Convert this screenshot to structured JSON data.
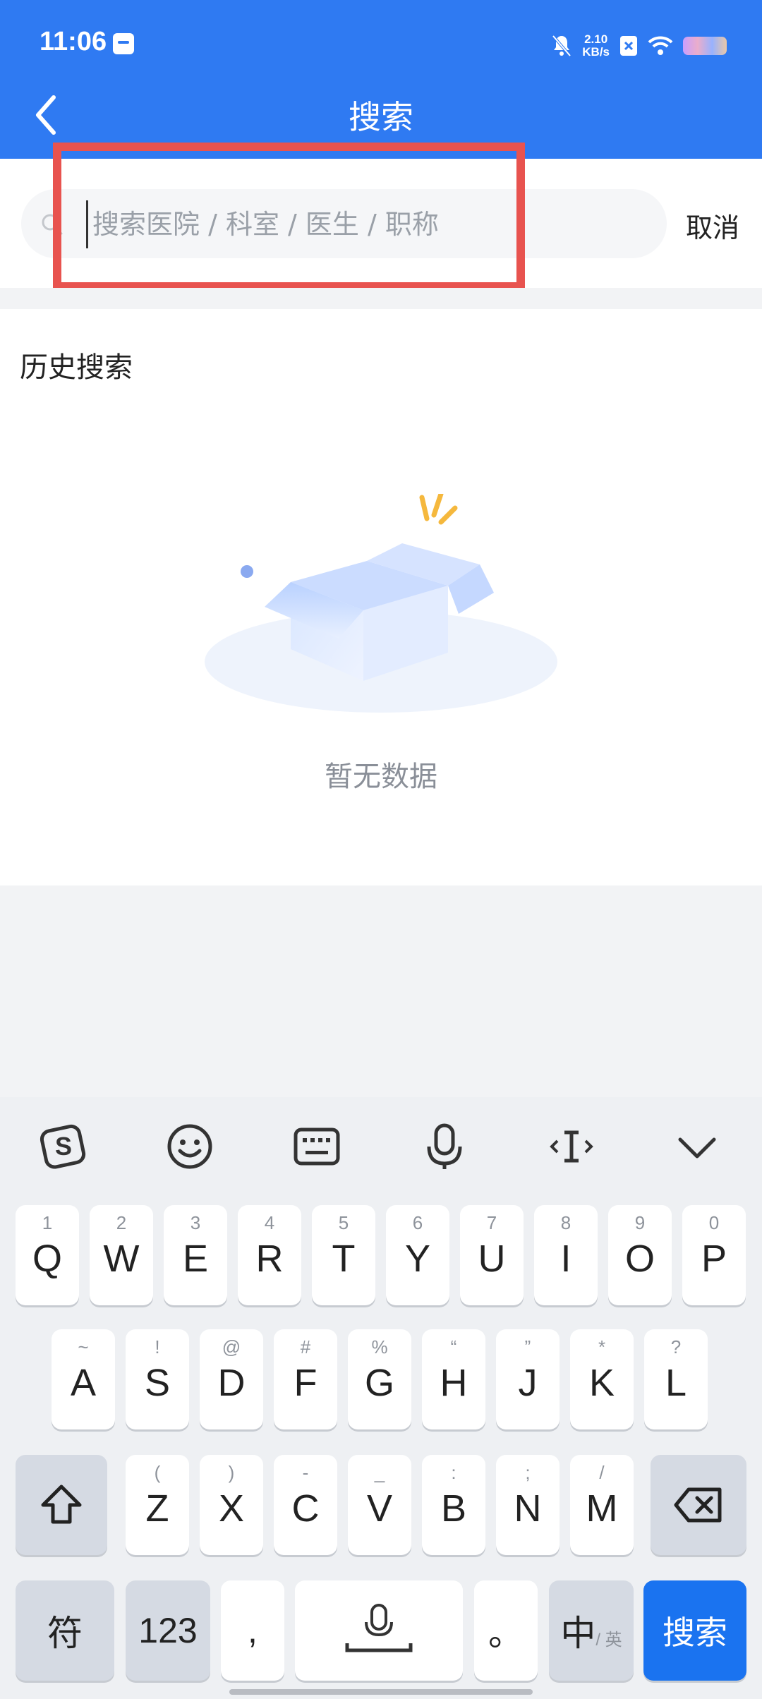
{
  "status_bar": {
    "time": "11:06",
    "net_speed_value": "2.10",
    "net_speed_unit": "KB/s"
  },
  "header": {
    "title": "搜索"
  },
  "search": {
    "placeholder": "搜索医院 / 科室 / 医生 / 职称",
    "value": "",
    "cancel_label": "取消"
  },
  "history": {
    "title": "历史搜索",
    "empty_text": "暂无数据"
  },
  "keyboard": {
    "toolbar": [
      "sogou-logo-icon",
      "emoji-icon",
      "keyboard-icon",
      "microphone-icon",
      "cursor-icon",
      "chevron-down-icon"
    ],
    "row1": [
      {
        "hint": "1",
        "key": "Q"
      },
      {
        "hint": "2",
        "key": "W"
      },
      {
        "hint": "3",
        "key": "E"
      },
      {
        "hint": "4",
        "key": "R"
      },
      {
        "hint": "5",
        "key": "T"
      },
      {
        "hint": "6",
        "key": "Y"
      },
      {
        "hint": "7",
        "key": "U"
      },
      {
        "hint": "8",
        "key": "I"
      },
      {
        "hint": "9",
        "key": "O"
      },
      {
        "hint": "0",
        "key": "P"
      }
    ],
    "row2": [
      {
        "hint": "~",
        "key": "A"
      },
      {
        "hint": "!",
        "key": "S"
      },
      {
        "hint": "@",
        "key": "D"
      },
      {
        "hint": "#",
        "key": "F"
      },
      {
        "hint": "%",
        "key": "G"
      },
      {
        "hint": "“",
        "key": "H"
      },
      {
        "hint": "”",
        "key": "J"
      },
      {
        "hint": "*",
        "key": "K"
      },
      {
        "hint": "?",
        "key": "L"
      }
    ],
    "row3": [
      {
        "hint": "(",
        "key": "Z"
      },
      {
        "hint": ")",
        "key": "X"
      },
      {
        "hint": "-",
        "key": "C"
      },
      {
        "hint": "_",
        "key": "V"
      },
      {
        "hint": ":",
        "key": "B"
      },
      {
        "hint": ";",
        "key": "N"
      },
      {
        "hint": "/",
        "key": "M"
      }
    ],
    "bottom": {
      "symbols": "符",
      "numbers": "123",
      "comma": ",",
      "period": "。",
      "lang_main": "中",
      "lang_alt": "/ 英",
      "search": "搜索"
    }
  },
  "colors": {
    "header_bg": "#2f7af2",
    "highlight_border": "#e8534f",
    "search_key_bg": "#1a73f0"
  }
}
